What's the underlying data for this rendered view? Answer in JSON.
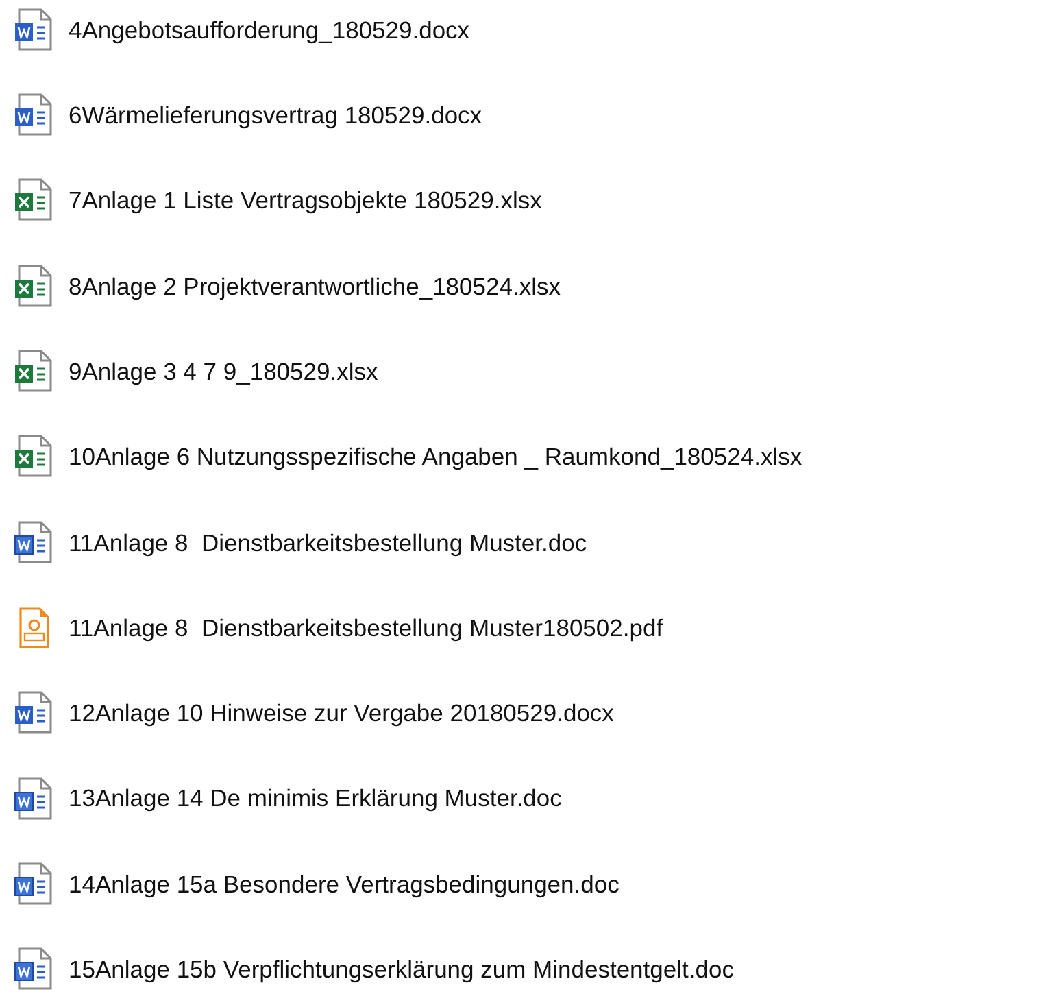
{
  "files": [
    {
      "name": "4Angebotsaufforderung_180529.docx",
      "kind": "docx"
    },
    {
      "name": "6Wärmelieferungsvertrag 180529.docx",
      "kind": "docx"
    },
    {
      "name": "7Anlage 1 Liste Vertragsobjekte 180529.xlsx",
      "kind": "xlsx"
    },
    {
      "name": "8Anlage 2 Projektverantwortliche_180524.xlsx",
      "kind": "xlsx"
    },
    {
      "name": "9Anlage 3 4 7 9_180529.xlsx",
      "kind": "xlsx"
    },
    {
      "name": "10Anlage 6 Nutzungsspezifische Angaben _ Raumkond_180524.xlsx",
      "kind": "xlsx"
    },
    {
      "name": "11Anlage 8  Dienstbarkeitsbestellung Muster.doc",
      "kind": "doc"
    },
    {
      "name": "11Anlage 8  Dienstbarkeitsbestellung Muster180502.pdf",
      "kind": "pdf"
    },
    {
      "name": "12Anlage 10 Hinweise zur Vergabe 20180529.docx",
      "kind": "docx"
    },
    {
      "name": "13Anlage 14 De minimis Erklärung Muster.doc",
      "kind": "doc"
    },
    {
      "name": "14Anlage 15a Besondere Vertragsbedingungen.doc",
      "kind": "doc"
    },
    {
      "name": "15Anlage 15b Verpflichtungserklärung zum Mindestentgelt.doc",
      "kind": "doc"
    }
  ]
}
